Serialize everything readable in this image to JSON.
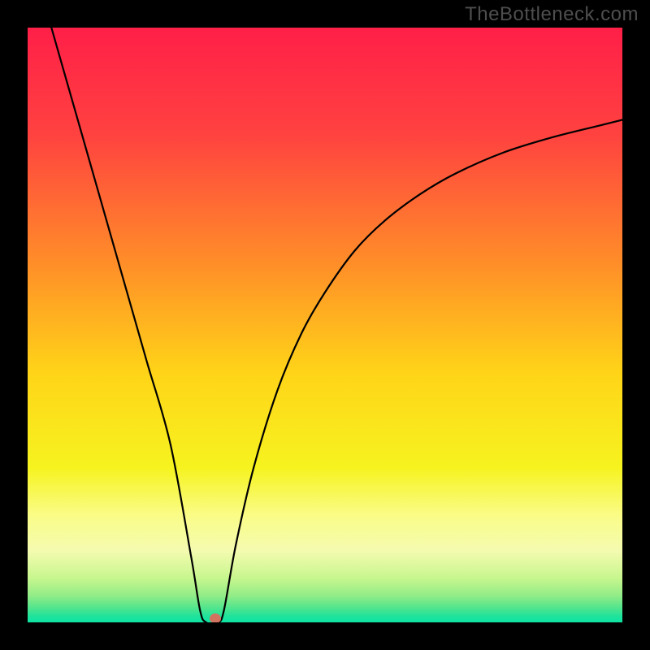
{
  "watermark": "TheBottleneck.com",
  "chart_data": {
    "type": "line",
    "title": "",
    "xlabel": "",
    "ylabel": "",
    "xlim": [
      0,
      1
    ],
    "ylim": [
      0,
      1
    ],
    "series": [
      {
        "name": "curve",
        "x": [
          0.04,
          0.08,
          0.12,
          0.16,
          0.2,
          0.24,
          0.275,
          0.29,
          0.3,
          0.32,
          0.33,
          0.35,
          0.38,
          0.42,
          0.46,
          0.5,
          0.55,
          0.6,
          0.66,
          0.72,
          0.8,
          0.88,
          0.96,
          1.0
        ],
        "y": [
          1.0,
          0.86,
          0.72,
          0.58,
          0.44,
          0.3,
          0.11,
          0.02,
          0.0,
          0.0,
          0.02,
          0.13,
          0.26,
          0.39,
          0.485,
          0.555,
          0.625,
          0.675,
          0.72,
          0.755,
          0.79,
          0.815,
          0.835,
          0.845
        ]
      }
    ],
    "marker": {
      "x": 0.315,
      "y": 0.007
    },
    "background_gradient_stops": [
      {
        "t": 0.0,
        "color": "#ff1f48"
      },
      {
        "t": 0.18,
        "color": "#ff4240"
      },
      {
        "t": 0.4,
        "color": "#ff8f28"
      },
      {
        "t": 0.58,
        "color": "#ffd418"
      },
      {
        "t": 0.74,
        "color": "#f6f31f"
      },
      {
        "t": 0.82,
        "color": "#fafc87"
      },
      {
        "t": 0.88,
        "color": "#f4fbb0"
      },
      {
        "t": 0.925,
        "color": "#c8f68e"
      },
      {
        "t": 0.955,
        "color": "#92ec87"
      },
      {
        "t": 0.975,
        "color": "#54e58c"
      },
      {
        "t": 0.99,
        "color": "#1de39c"
      },
      {
        "t": 1.0,
        "color": "#0ee3a3"
      }
    ]
  }
}
